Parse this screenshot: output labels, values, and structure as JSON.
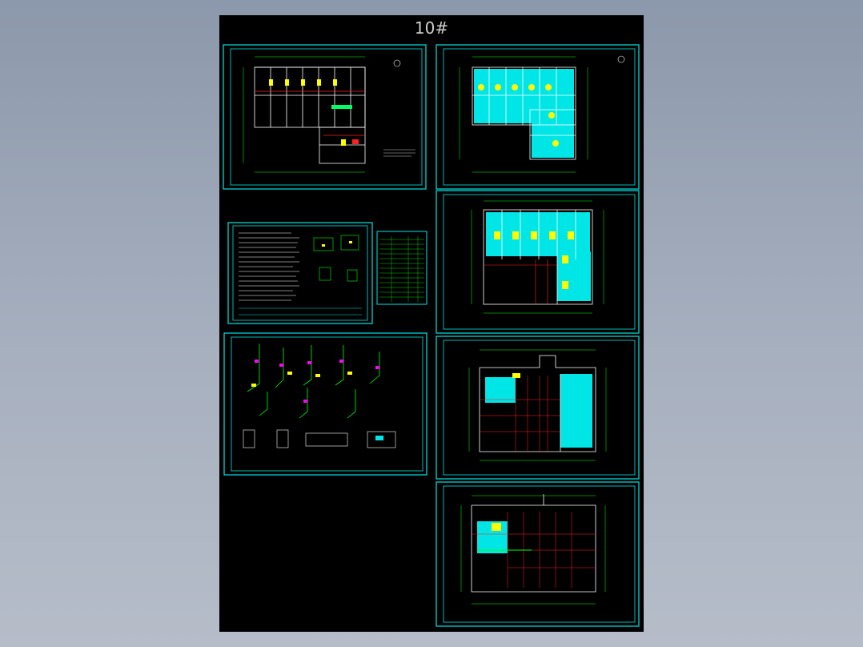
{
  "sheet": {
    "title": "10#"
  },
  "colors": {
    "background": "#000000",
    "frame": "#00e5e5",
    "wall": "#ffffff",
    "axis": "#00ff00",
    "room_fill": "#00e5e5",
    "fixture": "#ffff00",
    "pipe": "#ff2020",
    "accent": "#ff00ff"
  },
  "panels": [
    {
      "name": "floor-plan-1",
      "kind": "plan"
    },
    {
      "name": "floor-plan-2",
      "kind": "plan"
    },
    {
      "name": "design-notes",
      "kind": "notes"
    },
    {
      "name": "legend-table",
      "kind": "table"
    },
    {
      "name": "floor-plan-3",
      "kind": "plan"
    },
    {
      "name": "riser-diagrams",
      "kind": "isometric"
    },
    {
      "name": "floor-plan-4",
      "kind": "plan"
    },
    {
      "name": "floor-plan-5",
      "kind": "plan"
    }
  ]
}
